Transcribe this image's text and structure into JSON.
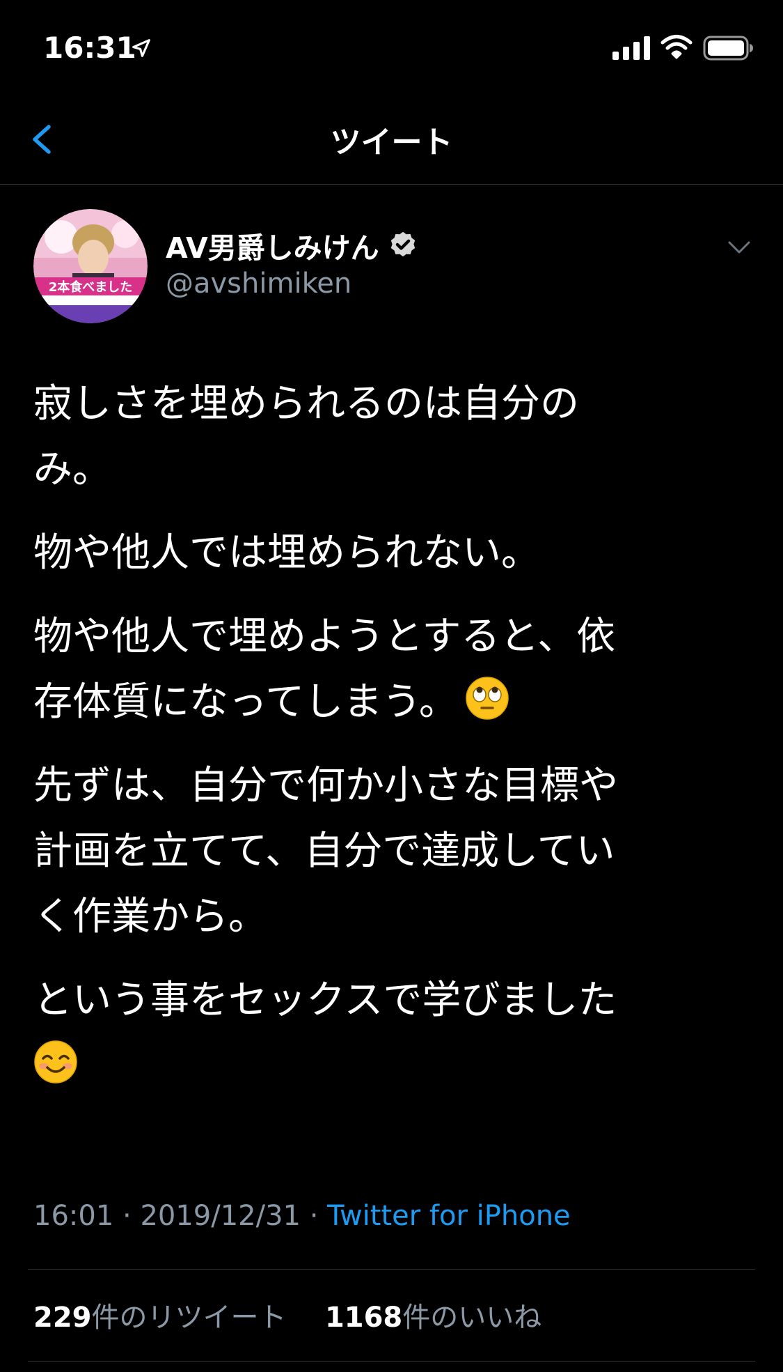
{
  "status_bar": {
    "time": "16:31",
    "icons": [
      "location-arrow-icon",
      "signal-icon",
      "wifi-icon",
      "battery-icon"
    ]
  },
  "nav": {
    "back_icon": "chevron-left-icon",
    "title": "ツイート"
  },
  "tweet": {
    "author": {
      "display_name": "AV男爵しみけん",
      "verified_icon": "verified-badge-icon",
      "username": "@avshimiken",
      "avatar_caption": "2本食べました"
    },
    "paragraphs": [
      "寂しさを埋められるのは自分の\nみ。",
      "物や他人では埋められない。",
      "物や他人で埋めようとすると、依\n存体質になってしまう。",
      "先ずは、自分で何か小さな目標や\n計画を立てて、自分で達成してい\nく作業から。",
      "という事をセックスで学びました\n"
    ],
    "emojis": [
      "eye-roll-emoji",
      "smiling-face-emoji"
    ],
    "time": "16:01",
    "separator": " · ",
    "date": "2019/12/31",
    "client": "Twitter for iPhone",
    "retweets": {
      "count": "229",
      "label": "件のリツイート"
    },
    "likes": {
      "count": "1168",
      "label": "件のいいね"
    }
  },
  "colors": {
    "background": "#000000",
    "text": "#ffffff",
    "secondary": "#8b98a5",
    "accent": "#1d9bf0",
    "divider": "#2f3336"
  }
}
